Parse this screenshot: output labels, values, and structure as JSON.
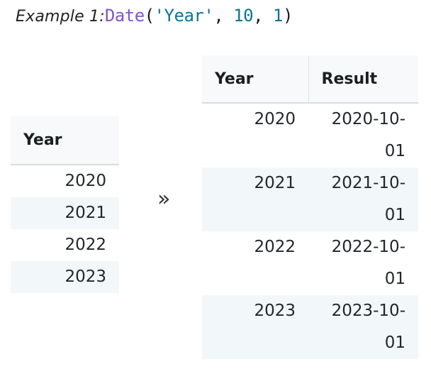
{
  "title": {
    "prefix": "Example 1:",
    "code": {
      "function_name": "Date",
      "open_paren": "(",
      "arg_string": "'Year'",
      "comma_1": ", ",
      "arg_number_1": "10",
      "comma_2": ", ",
      "arg_number_2": "1",
      "close_paren": ")"
    }
  },
  "colors": {
    "function": "#7e57c2",
    "string": "#0e7490",
    "number": "#0e7490",
    "punctuation": "#1a1a1a",
    "header_background": "#f8f9fa",
    "row_stripe": "#f2f7fa",
    "text": "#23272b"
  },
  "arrow": {
    "glyph": "»",
    "name": "double-chevron-right"
  },
  "input_table": {
    "columns": [
      "Year"
    ],
    "rows": [
      [
        "2020"
      ],
      [
        "2021"
      ],
      [
        "2022"
      ],
      [
        "2023"
      ]
    ]
  },
  "output_table": {
    "columns": [
      "Year",
      "Result"
    ],
    "rows": [
      [
        "2020",
        "2020-10-01"
      ],
      [
        "2021",
        "2021-10-01"
      ],
      [
        "2022",
        "2022-10-01"
      ],
      [
        "2023",
        "2023-10-01"
      ]
    ]
  }
}
